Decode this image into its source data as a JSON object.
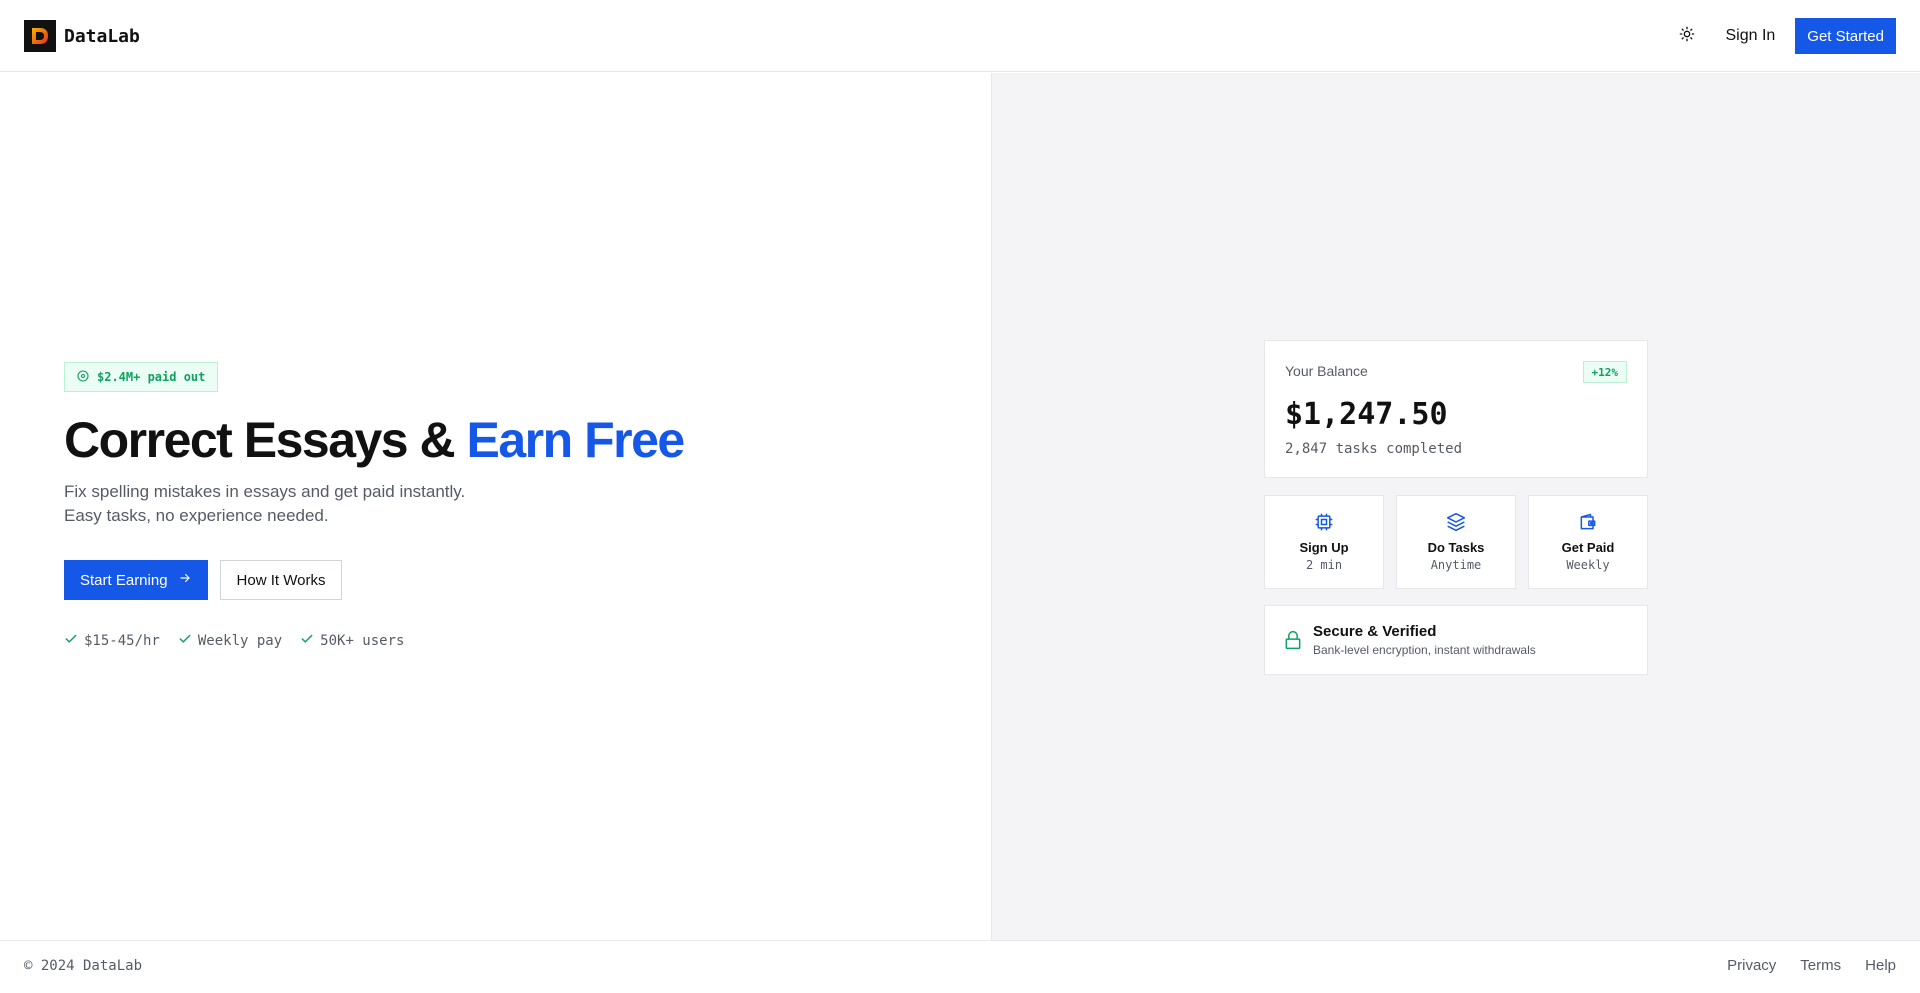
{
  "header": {
    "brand_name": "DataLab",
    "logo_icon": "datalab-logo",
    "theme_icon": "sun-icon",
    "signin_label": "Sign In",
    "getstarted_label": "Get Started"
  },
  "hero": {
    "badge_icon": "dollar-circle-icon",
    "badge_text": "$2.4M+ paid out",
    "headline_main": "Correct Essays & ",
    "headline_accent": "Earn Free",
    "subtitle_line1": "Fix spelling mistakes in essays and get paid instantly.",
    "subtitle_line2": "Easy tasks, no experience needed.",
    "primary_cta": "Start Earning",
    "secondary_cta": "How It Works",
    "features": [
      "$15-45/hr",
      "Weekly pay",
      "50K+ users"
    ]
  },
  "balance": {
    "label": "Your Balance",
    "change": "+12%",
    "amount": "$1,247.50",
    "tasks": "2,847 tasks completed"
  },
  "steps": [
    {
      "icon": "cpu-icon",
      "title": "Sign Up",
      "sub": "2 min"
    },
    {
      "icon": "layers-icon",
      "title": "Do Tasks",
      "sub": "Anytime"
    },
    {
      "icon": "wallet-icon",
      "title": "Get Paid",
      "sub": "Weekly"
    }
  ],
  "secure": {
    "icon": "lock-icon",
    "title": "Secure & Verified",
    "subtitle": "Bank-level encryption, instant withdrawals"
  },
  "footer": {
    "copyright": "© 2024 DataLab",
    "links": [
      "Privacy",
      "Terms",
      "Help"
    ]
  },
  "colors": {
    "accent": "#1557e6",
    "success": "#10a062",
    "panel_bg": "#f4f4f6"
  }
}
